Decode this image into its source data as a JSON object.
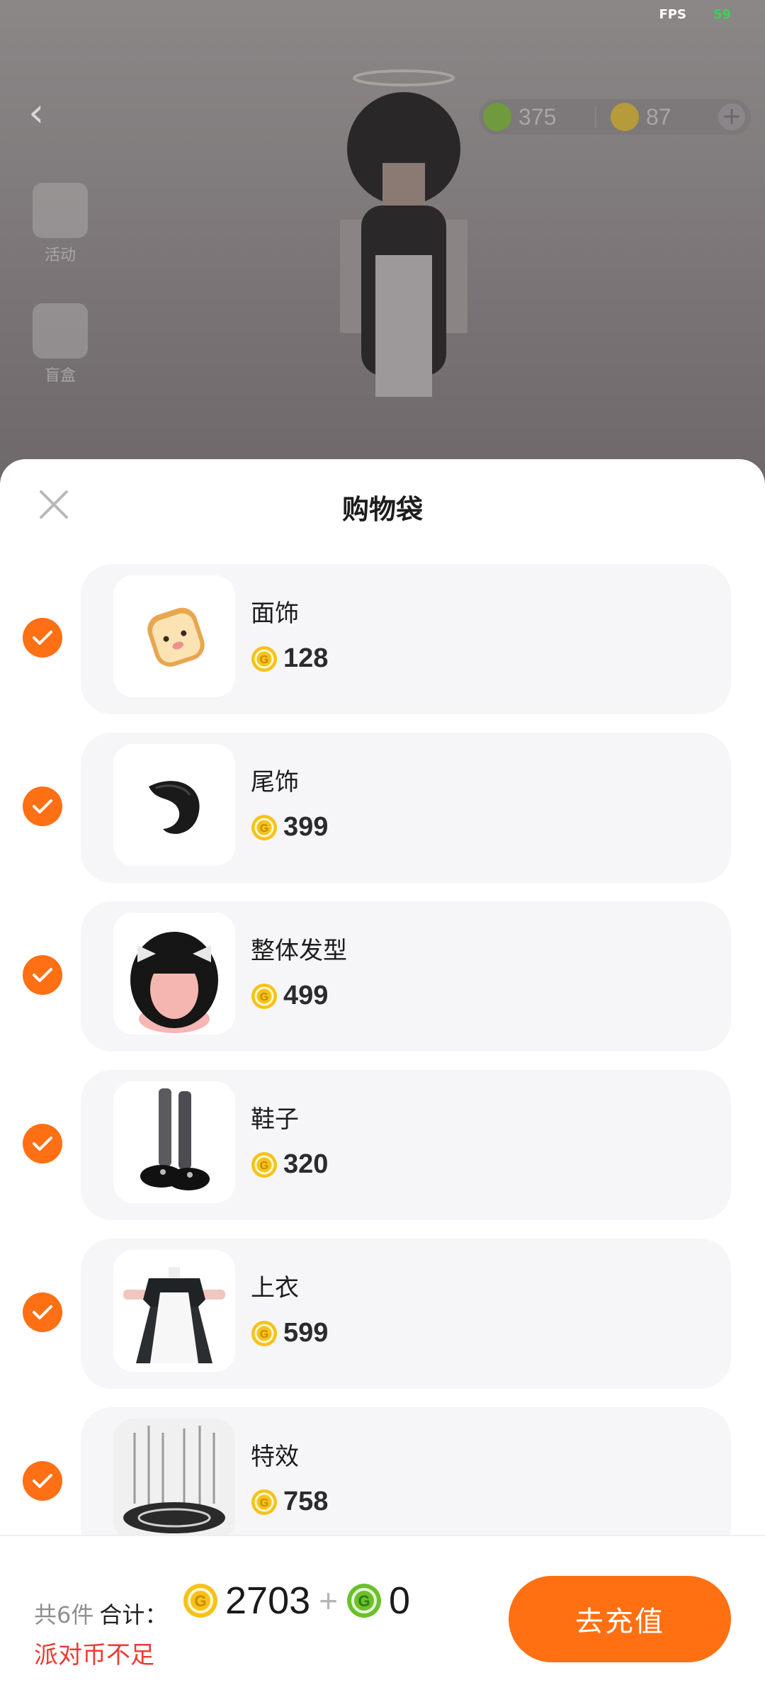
{
  "status": {
    "fps_label": "FPS",
    "fps_value": "59"
  },
  "scene": {
    "currency_green": "375",
    "currency_yellow": "87",
    "side_buttons": [
      "活动",
      "盲盒"
    ]
  },
  "sheet": {
    "title": "购物袋",
    "items": [
      {
        "name": "面饰",
        "price": "128",
        "checked": true,
        "thumb": "toast-face-icon"
      },
      {
        "name": "尾饰",
        "price": "399",
        "checked": true,
        "thumb": "black-tail-icon"
      },
      {
        "name": "整体发型",
        "price": "499",
        "checked": true,
        "thumb": "hairstyle-icon"
      },
      {
        "name": "鞋子",
        "price": "320",
        "checked": true,
        "thumb": "shoes-icon"
      },
      {
        "name": "上衣",
        "price": "599",
        "checked": true,
        "thumb": "maid-top-icon"
      },
      {
        "name": "特效",
        "price": "758",
        "checked": true,
        "thumb": "effect-icon"
      }
    ]
  },
  "footer": {
    "count_text": "共6件",
    "total_label": "合计：",
    "total_coins": "2703",
    "plus": "+",
    "total_party": "0",
    "warning": "派对币不足",
    "recharge_label": "去充值"
  },
  "colors": {
    "accent": "#ff7012",
    "warning": "#ee3b32",
    "coin_yellow": "#f6c21a",
    "coin_green": "#6cc02c"
  }
}
